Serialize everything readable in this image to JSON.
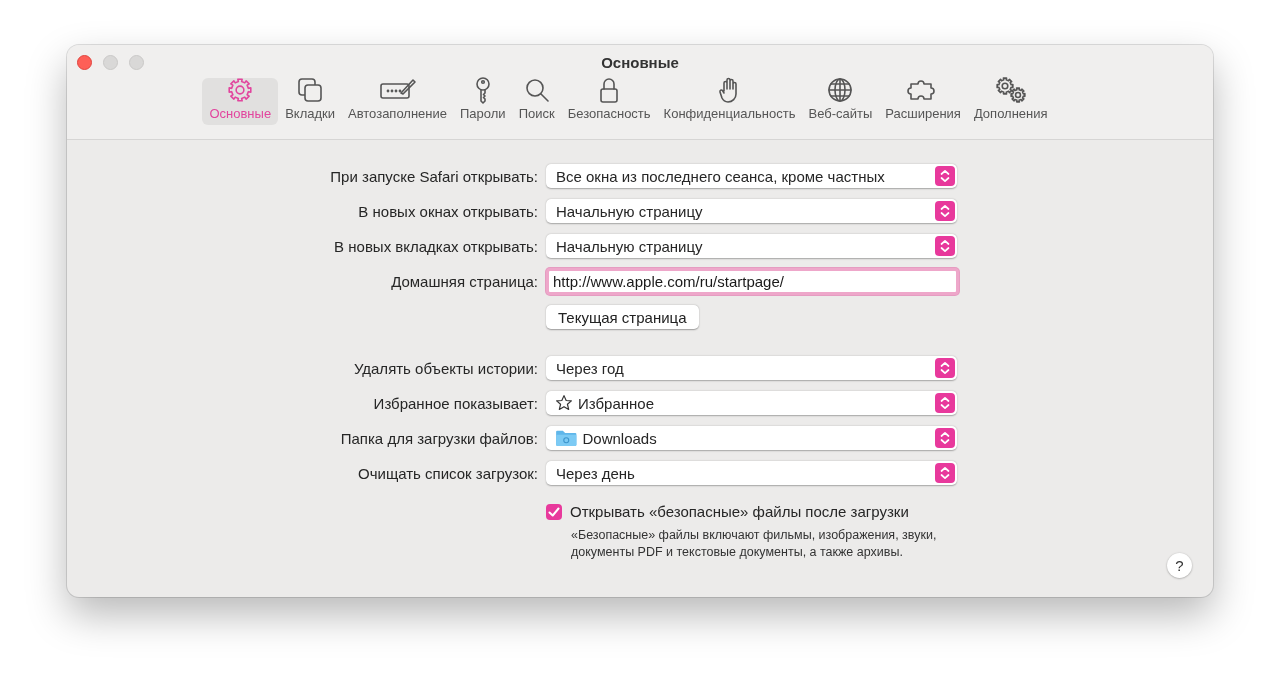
{
  "window": {
    "title": "Основные"
  },
  "tabs": [
    {
      "label": "Основные",
      "selected": true
    },
    {
      "label": "Вкладки",
      "selected": false
    },
    {
      "label": "Автозаполнение",
      "selected": false
    },
    {
      "label": "Пароли",
      "selected": false
    },
    {
      "label": "Поиск",
      "selected": false
    },
    {
      "label": "Безопасность",
      "selected": false
    },
    {
      "label": "Конфиденциальность",
      "selected": false
    },
    {
      "label": "Веб-сайты",
      "selected": false
    },
    {
      "label": "Расширения",
      "selected": false
    },
    {
      "label": "Дополнения",
      "selected": false
    }
  ],
  "startup_settings": [
    {
      "kind": "popup",
      "label": "При запуске Safari открывать:",
      "value": "Все окна из последнего сеанса, кроме частных"
    },
    {
      "kind": "popup",
      "label": "В новых окнах открывать:",
      "value": "Начальную страницу"
    },
    {
      "kind": "popup",
      "label": "В новых вкладках открывать:",
      "value": "Начальную страницу"
    },
    {
      "kind": "field",
      "label": "Домашняя страница:",
      "value": "http://www.apple.com/ru/startpage/"
    },
    {
      "kind": "button",
      "value": "Текущая страница"
    }
  ],
  "history_settings": [
    {
      "kind": "popup",
      "label": "Удалять объекты истории:",
      "value": "Через год"
    },
    {
      "kind": "starpopup",
      "label": "Избранное показывает:",
      "value": "Избранное"
    },
    {
      "kind": "folderpopup",
      "label": "Папка для загрузки файлов:",
      "value": "Downloads"
    },
    {
      "kind": "popup",
      "label": "Очищать список загрузок:",
      "value": "Через день"
    }
  ],
  "open_safe_files": {
    "label": "Открывать «безопасные» файлы после загрузки",
    "checked": true,
    "note": "«Безопасные» файлы включают фильмы, изображения, звуки, документы PDF и текстовые документы, а также архивы."
  },
  "help_button": {
    "label": "?"
  }
}
